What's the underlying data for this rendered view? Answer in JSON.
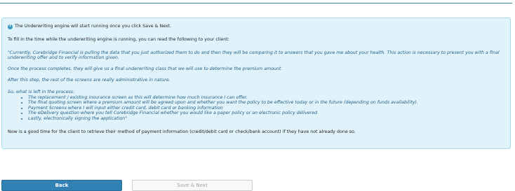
{
  "notice": {
    "icon": "info-icon",
    "text": "The Underwriting engine will start running once you click Save & Next."
  },
  "intro": "To fill in the time while the underwriting engine is running, you can read the following to your client:",
  "script": {
    "p1": "\"Currently, Corebridge Financial is pulling the data that you just authorized them to do and then they will be comparing it to answers that you gave me about your health. This action is necessary to present you with a final underwriting offer and to verify information given.",
    "p2": "Once the process completes, they will give us a final underwriting class that we will use to determine the premium amount.",
    "p3": "After this step, the rest of the screens are really administrative in nature.",
    "p4": "So, what is left in the process:",
    "items": [
      "The replacement / existing insurance screen as this will determine how much insurance I can offer.",
      "The final quoting screen where a premium amount will be agreed upon and whether you want the policy to be effective today or in the future (depending on funds availability).",
      "Payment Screens where I will input either credit card, debit card or banking information",
      "The eDelivery question where you tell Corebridge Financial whether you would like a paper policy or an electronic policy delivered",
      "Lastly, electronically signing the application\""
    ]
  },
  "closing": "Now is a good time for the client to retrieve their method of payment information (credit/debit card or check/bank account) if they have not already done so.",
  "buttons": {
    "back": "Back",
    "save_next": "Save & Next"
  },
  "colors": {
    "panel_bg": "#e1f3fa",
    "panel_border": "#a8d8ea",
    "script_text": "#1f5c86",
    "primary_button": "#3281b4",
    "disabled_text": "#a4a4a4"
  }
}
